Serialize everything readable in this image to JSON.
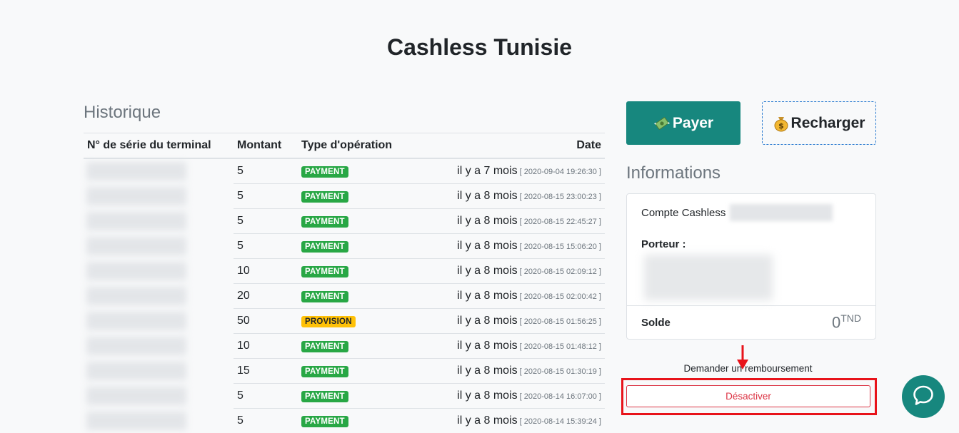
{
  "app": {
    "title": "Cashless Tunisie"
  },
  "history": {
    "title": "Historique",
    "columns": {
      "serial": "N° de série du terminal",
      "amount": "Montant",
      "type": "Type d'opération",
      "date": "Date"
    },
    "rows": [
      {
        "amount": "5",
        "type": "PAYMENT",
        "relative": "il y a 7 mois",
        "date": "[ 2020-09-04 19:26:30 ]"
      },
      {
        "amount": "5",
        "type": "PAYMENT",
        "relative": "il y a 8 mois",
        "date": "[ 2020-08-15 23:00:23 ]"
      },
      {
        "amount": "5",
        "type": "PAYMENT",
        "relative": "il y a 8 mois",
        "date": "[ 2020-08-15 22:45:27 ]"
      },
      {
        "amount": "5",
        "type": "PAYMENT",
        "relative": "il y a 8 mois",
        "date": "[ 2020-08-15 15:06:20 ]"
      },
      {
        "amount": "10",
        "type": "PAYMENT",
        "relative": "il y a 8 mois",
        "date": "[ 2020-08-15 02:09:12 ]"
      },
      {
        "amount": "20",
        "type": "PAYMENT",
        "relative": "il y a 8 mois",
        "date": "[ 2020-08-15 02:00:42 ]"
      },
      {
        "amount": "50",
        "type": "PROVISION",
        "relative": "il y a 8 mois",
        "date": "[ 2020-08-15 01:56:25 ]"
      },
      {
        "amount": "10",
        "type": "PAYMENT",
        "relative": "il y a 8 mois",
        "date": "[ 2020-08-15 01:48:12 ]"
      },
      {
        "amount": "15",
        "type": "PAYMENT",
        "relative": "il y a 8 mois",
        "date": "[ 2020-08-15 01:30:19 ]"
      },
      {
        "amount": "5",
        "type": "PAYMENT",
        "relative": "il y a 8 mois",
        "date": "[ 2020-08-14 16:07:00 ]"
      },
      {
        "amount": "5",
        "type": "PAYMENT",
        "relative": "il y a 8 mois",
        "date": "[ 2020-08-14 15:39:24 ]"
      }
    ]
  },
  "actions": {
    "pay": {
      "label": "Payer",
      "icon": "money-wings-icon"
    },
    "recharge": {
      "label": "Recharger",
      "icon": "money-bag-icon"
    }
  },
  "info": {
    "title": "Informations",
    "account_label": "Compte Cashless",
    "holder_label": "Porteur :",
    "balance_label": "Solde",
    "balance_value": "0",
    "balance_unit": "TND"
  },
  "refund": {
    "text": "Demander un remboursement",
    "deactivate_label": "Désactiver"
  },
  "colors": {
    "primary": "#17877e",
    "payment_badge": "#28a745",
    "provision_badge": "#ffc107",
    "danger": "#dc3545",
    "annotation": "#e8131a"
  }
}
